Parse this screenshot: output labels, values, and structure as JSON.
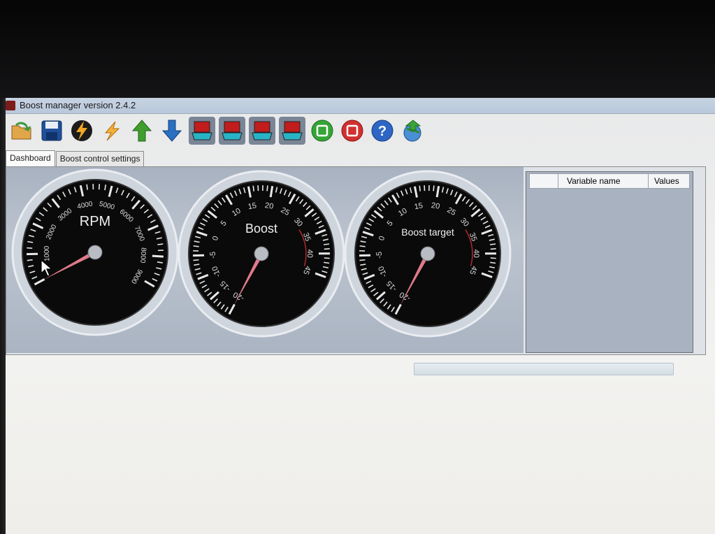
{
  "window": {
    "title": "Boost manager version 2.4.2"
  },
  "toolbar": {
    "buttons": [
      {
        "icon": "open-folder-icon"
      },
      {
        "icon": "save-disk-icon"
      },
      {
        "icon": "connect-lightning-icon"
      },
      {
        "icon": "disconnect-lightning-icon"
      },
      {
        "icon": "upload-arrow-icon"
      },
      {
        "icon": "download-arrow-icon"
      },
      {
        "icon": "laptop-1-icon"
      },
      {
        "icon": "laptop-2-icon"
      },
      {
        "icon": "laptop-3-icon"
      },
      {
        "icon": "laptop-4-icon"
      },
      {
        "icon": "start-icon"
      },
      {
        "icon": "stop-icon"
      },
      {
        "icon": "help-icon"
      },
      {
        "icon": "update-globe-icon"
      }
    ]
  },
  "tabs": [
    {
      "label": "Dashboard",
      "active": true
    },
    {
      "label": "Boost control settings",
      "active": false
    }
  ],
  "gauges": {
    "rpm": {
      "title": "RPM",
      "labels": [
        "1000",
        "2000",
        "3000",
        "4000",
        "5000",
        "6000",
        "7000",
        "8000",
        "9000"
      ],
      "value": 0
    },
    "boost": {
      "title": "Boost",
      "labels": [
        "-20",
        "-15",
        "-10",
        "-5",
        "0",
        "5",
        "10",
        "15",
        "20",
        "25",
        "30",
        "35",
        "40",
        "45"
      ],
      "value": -20
    },
    "boost_target": {
      "title": "Boost target",
      "labels": [
        "-20",
        "-15",
        "-10",
        "-5",
        "0",
        "5",
        "10",
        "15",
        "20",
        "25",
        "30",
        "35",
        "40",
        "45"
      ],
      "value": -20
    }
  },
  "variables_table": {
    "columns": [
      "",
      "Variable name",
      "Values"
    ],
    "rows": []
  },
  "progress": {
    "value": 0
  },
  "colors": {
    "needle": "#e07a8a",
    "gauge_face": "#0a0a0a",
    "ticks": "#e8e8e8"
  }
}
